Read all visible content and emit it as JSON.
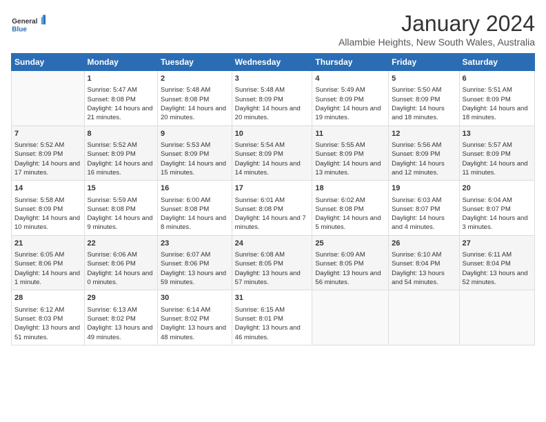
{
  "header": {
    "logo_general": "General",
    "logo_blue": "Blue",
    "title": "January 2024",
    "location": "Allambie Heights, New South Wales, Australia"
  },
  "days_of_week": [
    "Sunday",
    "Monday",
    "Tuesday",
    "Wednesday",
    "Thursday",
    "Friday",
    "Saturday"
  ],
  "weeks": [
    [
      {
        "day": "",
        "empty": true
      },
      {
        "day": "1",
        "sunrise": "5:47 AM",
        "sunset": "8:08 PM",
        "daylight": "14 hours and 21 minutes."
      },
      {
        "day": "2",
        "sunrise": "5:48 AM",
        "sunset": "8:08 PM",
        "daylight": "14 hours and 20 minutes."
      },
      {
        "day": "3",
        "sunrise": "5:48 AM",
        "sunset": "8:09 PM",
        "daylight": "14 hours and 20 minutes."
      },
      {
        "day": "4",
        "sunrise": "5:49 AM",
        "sunset": "8:09 PM",
        "daylight": "14 hours and 19 minutes."
      },
      {
        "day": "5",
        "sunrise": "5:50 AM",
        "sunset": "8:09 PM",
        "daylight": "14 hours and 18 minutes."
      },
      {
        "day": "6",
        "sunrise": "5:51 AM",
        "sunset": "8:09 PM",
        "daylight": "14 hours and 18 minutes."
      }
    ],
    [
      {
        "day": "7",
        "sunrise": "5:52 AM",
        "sunset": "8:09 PM",
        "daylight": "14 hours and 17 minutes."
      },
      {
        "day": "8",
        "sunrise": "5:52 AM",
        "sunset": "8:09 PM",
        "daylight": "14 hours and 16 minutes."
      },
      {
        "day": "9",
        "sunrise": "5:53 AM",
        "sunset": "8:09 PM",
        "daylight": "14 hours and 15 minutes."
      },
      {
        "day": "10",
        "sunrise": "5:54 AM",
        "sunset": "8:09 PM",
        "daylight": "14 hours and 14 minutes."
      },
      {
        "day": "11",
        "sunrise": "5:55 AM",
        "sunset": "8:09 PM",
        "daylight": "14 hours and 13 minutes."
      },
      {
        "day": "12",
        "sunrise": "5:56 AM",
        "sunset": "8:09 PM",
        "daylight": "14 hours and 12 minutes."
      },
      {
        "day": "13",
        "sunrise": "5:57 AM",
        "sunset": "8:09 PM",
        "daylight": "14 hours and 11 minutes."
      }
    ],
    [
      {
        "day": "14",
        "sunrise": "5:58 AM",
        "sunset": "8:09 PM",
        "daylight": "14 hours and 10 minutes."
      },
      {
        "day": "15",
        "sunrise": "5:59 AM",
        "sunset": "8:08 PM",
        "daylight": "14 hours and 9 minutes."
      },
      {
        "day": "16",
        "sunrise": "6:00 AM",
        "sunset": "8:08 PM",
        "daylight": "14 hours and 8 minutes."
      },
      {
        "day": "17",
        "sunrise": "6:01 AM",
        "sunset": "8:08 PM",
        "daylight": "14 hours and 7 minutes."
      },
      {
        "day": "18",
        "sunrise": "6:02 AM",
        "sunset": "8:08 PM",
        "daylight": "14 hours and 5 minutes."
      },
      {
        "day": "19",
        "sunrise": "6:03 AM",
        "sunset": "8:07 PM",
        "daylight": "14 hours and 4 minutes."
      },
      {
        "day": "20",
        "sunrise": "6:04 AM",
        "sunset": "8:07 PM",
        "daylight": "14 hours and 3 minutes."
      }
    ],
    [
      {
        "day": "21",
        "sunrise": "6:05 AM",
        "sunset": "8:06 PM",
        "daylight": "14 hours and 1 minute."
      },
      {
        "day": "22",
        "sunrise": "6:06 AM",
        "sunset": "8:06 PM",
        "daylight": "14 hours and 0 minutes."
      },
      {
        "day": "23",
        "sunrise": "6:07 AM",
        "sunset": "8:06 PM",
        "daylight": "13 hours and 59 minutes."
      },
      {
        "day": "24",
        "sunrise": "6:08 AM",
        "sunset": "8:05 PM",
        "daylight": "13 hours and 57 minutes."
      },
      {
        "day": "25",
        "sunrise": "6:09 AM",
        "sunset": "8:05 PM",
        "daylight": "13 hours and 56 minutes."
      },
      {
        "day": "26",
        "sunrise": "6:10 AM",
        "sunset": "8:04 PM",
        "daylight": "13 hours and 54 minutes."
      },
      {
        "day": "27",
        "sunrise": "6:11 AM",
        "sunset": "8:04 PM",
        "daylight": "13 hours and 52 minutes."
      }
    ],
    [
      {
        "day": "28",
        "sunrise": "6:12 AM",
        "sunset": "8:03 PM",
        "daylight": "13 hours and 51 minutes."
      },
      {
        "day": "29",
        "sunrise": "6:13 AM",
        "sunset": "8:02 PM",
        "daylight": "13 hours and 49 minutes."
      },
      {
        "day": "30",
        "sunrise": "6:14 AM",
        "sunset": "8:02 PM",
        "daylight": "13 hours and 48 minutes."
      },
      {
        "day": "31",
        "sunrise": "6:15 AM",
        "sunset": "8:01 PM",
        "daylight": "13 hours and 46 minutes."
      },
      {
        "day": "",
        "empty": true
      },
      {
        "day": "",
        "empty": true
      },
      {
        "day": "",
        "empty": true
      }
    ]
  ]
}
